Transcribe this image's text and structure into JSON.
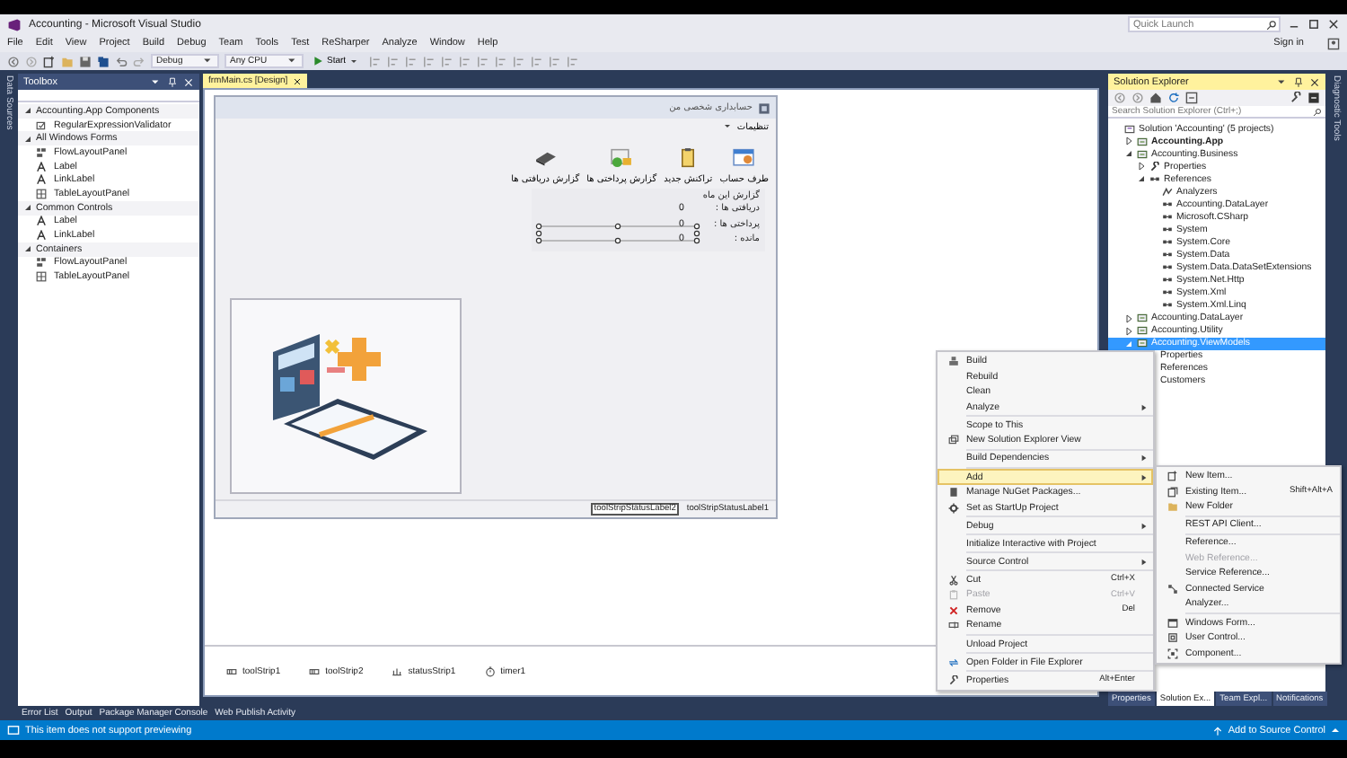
{
  "window": {
    "title": "Accounting - Microsoft Visual Studio",
    "quick_launch": {
      "placeholder": "Quick Launch"
    },
    "sign_in": "Sign in"
  },
  "menu": [
    "File",
    "Edit",
    "View",
    "Project",
    "Build",
    "Debug",
    "Team",
    "Tools",
    "Test",
    "ReSharper",
    "Analyze",
    "Window",
    "Help"
  ],
  "toolbar": {
    "configuration": "Debug",
    "platform": "Any CPU",
    "start": "Start"
  },
  "left_side_tabs": [
    "Data Sources"
  ],
  "toolbox": {
    "title": "Toolbox",
    "groups": [
      {
        "label": "Accounting.App Components",
        "expanded": true,
        "items": [
          {
            "label": "RegularExpressionValidator",
            "kind": "validator"
          }
        ]
      },
      {
        "label": "All Windows Forms",
        "expanded": true,
        "items": [
          {
            "label": "FlowLayoutPanel",
            "kind": "flow"
          },
          {
            "label": "Label",
            "kind": "label"
          },
          {
            "label": "LinkLabel",
            "kind": "label"
          },
          {
            "label": "TableLayoutPanel",
            "kind": "table"
          }
        ]
      },
      {
        "label": "Common Controls",
        "expanded": true,
        "items": [
          {
            "label": "Label",
            "kind": "label"
          },
          {
            "label": "LinkLabel",
            "kind": "label"
          }
        ]
      },
      {
        "label": "Containers",
        "expanded": true,
        "items": [
          {
            "label": "FlowLayoutPanel",
            "kind": "flow"
          },
          {
            "label": "TableLayoutPanel",
            "kind": "table"
          }
        ]
      }
    ]
  },
  "document_tab": {
    "label": "frmMain.cs [Design]",
    "selected": true
  },
  "form": {
    "title": "حسابداری شخصی من",
    "menu": [
      {
        "label": "تنظیمات",
        "dropdown": true
      }
    ],
    "tools": [
      {
        "label": "طرف حساب",
        "kind": "contacts"
      },
      {
        "label": "تراکنش جدید",
        "kind": "clipboard"
      },
      {
        "label": "گزارش پرداختی ها",
        "kind": "report"
      },
      {
        "label": "گزارش دریافتی ها",
        "kind": "wallet"
      }
    ],
    "report": {
      "title": "گزارش این ماه",
      "rows": [
        {
          "label": "دریافتی ها :",
          "value": "0"
        },
        {
          "label": "پرداختی ها :",
          "value": "0"
        },
        {
          "label": "مانده :",
          "value": "0"
        }
      ]
    },
    "status_labels": [
      {
        "label": "toolStripStatusLabel2",
        "selected": true
      },
      {
        "label": "toolStripStatusLabel1",
        "selected": false
      }
    ]
  },
  "component_tray": [
    {
      "label": "toolStrip1",
      "kind": "toolstrip"
    },
    {
      "label": "toolStrip2",
      "kind": "toolstrip"
    },
    {
      "label": "statusStrip1",
      "kind": "statusstrip"
    },
    {
      "label": "timer1",
      "kind": "timer"
    }
  ],
  "bottom_tabs": [
    "Error List",
    "Output",
    "Package Manager Console",
    "Web Publish Activity"
  ],
  "solution_explorer": {
    "title": "Solution Explorer",
    "search": {
      "placeholder": "Search Solution Explorer (Ctrl+;)"
    },
    "tree": [
      {
        "label": "Solution 'Accounting' (5 projects)",
        "kind": "solution",
        "selected": false,
        "startup": false,
        "children": [
          {
            "label": "Accounting.App",
            "kind": "project",
            "expanded": false,
            "selected": false,
            "startup": true
          },
          {
            "label": "Accounting.Business",
            "kind": "project",
            "expanded": true,
            "selected": false,
            "startup": false,
            "children": [
              {
                "label": "Properties",
                "kind": "properties",
                "expanded": false,
                "selected": false,
                "startup": false
              },
              {
                "label": "References",
                "kind": "references",
                "expanded": true,
                "selected": false,
                "startup": false,
                "children": [
                  {
                    "label": "Analyzers",
                    "kind": "analyzer",
                    "selected": false,
                    "startup": false
                  },
                  {
                    "label": "Accounting.DataLayer",
                    "kind": "reference",
                    "selected": false,
                    "startup": false
                  },
                  {
                    "label": "Microsoft.CSharp",
                    "kind": "reference",
                    "selected": false,
                    "startup": false
                  },
                  {
                    "label": "System",
                    "kind": "reference",
                    "selected": false,
                    "startup": false
                  },
                  {
                    "label": "System.Core",
                    "kind": "reference",
                    "selected": false,
                    "startup": false
                  },
                  {
                    "label": "System.Data",
                    "kind": "reference",
                    "selected": false,
                    "startup": false
                  },
                  {
                    "label": "System.Data.DataSetExtensions",
                    "kind": "reference",
                    "selected": false,
                    "startup": false
                  },
                  {
                    "label": "System.Net.Http",
                    "kind": "reference",
                    "selected": false,
                    "startup": false
                  },
                  {
                    "label": "System.Xml",
                    "kind": "reference",
                    "selected": false,
                    "startup": false
                  },
                  {
                    "label": "System.Xml.Linq",
                    "kind": "reference",
                    "selected": false,
                    "startup": false
                  }
                ]
              }
            ]
          },
          {
            "label": "Accounting.DataLayer",
            "kind": "project",
            "expanded": false,
            "selected": false,
            "startup": false
          },
          {
            "label": "Accounting.Utility",
            "kind": "project",
            "expanded": false,
            "selected": false,
            "startup": false
          },
          {
            "label": "Accounting.ViewModels",
            "kind": "project",
            "expanded": true,
            "selected": true,
            "startup": false,
            "children": [
              {
                "label": "Properties",
                "kind": "plain",
                "selected": false,
                "startup": false
              },
              {
                "label": "References",
                "kind": "plain",
                "selected": false,
                "startup": false
              },
              {
                "label": "Customers",
                "kind": "plain",
                "selected": false,
                "startup": false
              }
            ]
          }
        ]
      }
    ]
  },
  "right_tabs": [
    {
      "label": "Properties",
      "selected": false
    },
    {
      "label": "Solution Ex...",
      "selected": true
    },
    {
      "label": "Team Expl...",
      "selected": false
    },
    {
      "label": "Notifications",
      "selected": false
    }
  ],
  "right_side_tabs": [
    "Diagnostic Tools"
  ],
  "context_menu": {
    "groups": [
      [
        {
          "label": "Build",
          "submenu": false,
          "disabled": false,
          "selected": false
        },
        {
          "label": "Rebuild",
          "submenu": false,
          "disabled": false,
          "selected": false
        },
        {
          "label": "Clean",
          "submenu": false,
          "disabled": false,
          "selected": false
        },
        {
          "label": "Analyze",
          "submenu": true,
          "disabled": false,
          "selected": false
        }
      ],
      [
        {
          "label": "Scope to This",
          "submenu": false,
          "disabled": false,
          "selected": false
        },
        {
          "label": "New Solution Explorer View",
          "submenu": false,
          "disabled": false,
          "selected": false
        }
      ],
      [
        {
          "label": "Build Dependencies",
          "submenu": true,
          "disabled": false,
          "selected": false
        }
      ],
      [
        {
          "label": "Add",
          "submenu": true,
          "disabled": false,
          "selected": true
        },
        {
          "label": "Manage NuGet Packages...",
          "submenu": false,
          "disabled": false,
          "selected": false
        },
        {
          "label": "Set as StartUp Project",
          "submenu": false,
          "disabled": false,
          "selected": false
        }
      ],
      [
        {
          "label": "Debug",
          "submenu": true,
          "disabled": false,
          "selected": false
        }
      ],
      [
        {
          "label": "Initialize Interactive with Project",
          "submenu": false,
          "disabled": false,
          "selected": false
        }
      ],
      [
        {
          "label": "Source Control",
          "submenu": true,
          "disabled": false,
          "selected": false
        }
      ],
      [
        {
          "label": "Cut",
          "shortcut": "Ctrl+X",
          "submenu": false,
          "disabled": false,
          "selected": false
        },
        {
          "label": "Paste",
          "shortcut": "Ctrl+V",
          "submenu": false,
          "disabled": true,
          "selected": false
        },
        {
          "label": "Remove",
          "shortcut": "Del",
          "submenu": false,
          "disabled": false,
          "selected": false
        },
        {
          "label": "Rename",
          "submenu": false,
          "disabled": false,
          "selected": false
        }
      ],
      [
        {
          "label": "Unload Project",
          "submenu": false,
          "disabled": false,
          "selected": false
        }
      ],
      [
        {
          "label": "Open Folder in File Explorer",
          "submenu": false,
          "disabled": false,
          "selected": false
        }
      ],
      [
        {
          "label": "Properties",
          "shortcut": "Alt+Enter",
          "submenu": false,
          "disabled": false,
          "selected": false
        }
      ]
    ]
  },
  "add_submenu": {
    "groups": [
      [
        {
          "label": "New Item...",
          "disabled": false
        },
        {
          "label": "Existing Item...",
          "shortcut": "Shift+Alt+A",
          "disabled": false
        },
        {
          "label": "New Folder",
          "disabled": false
        }
      ],
      [
        {
          "label": "REST API Client...",
          "disabled": false
        }
      ],
      [
        {
          "label": "Reference...",
          "disabled": false
        },
        {
          "label": "Web Reference...",
          "disabled": true
        },
        {
          "label": "Service Reference...",
          "disabled": false
        },
        {
          "label": "Connected Service",
          "disabled": false
        },
        {
          "label": "Analyzer...",
          "disabled": false
        }
      ],
      [
        {
          "label": "Windows Form...",
          "disabled": false
        },
        {
          "label": "User Control...",
          "disabled": false
        },
        {
          "label": "Component...",
          "disabled": false
        }
      ]
    ]
  },
  "status_bar": {
    "message": "This item does not support previewing",
    "source_control": "Add to Source Control"
  }
}
